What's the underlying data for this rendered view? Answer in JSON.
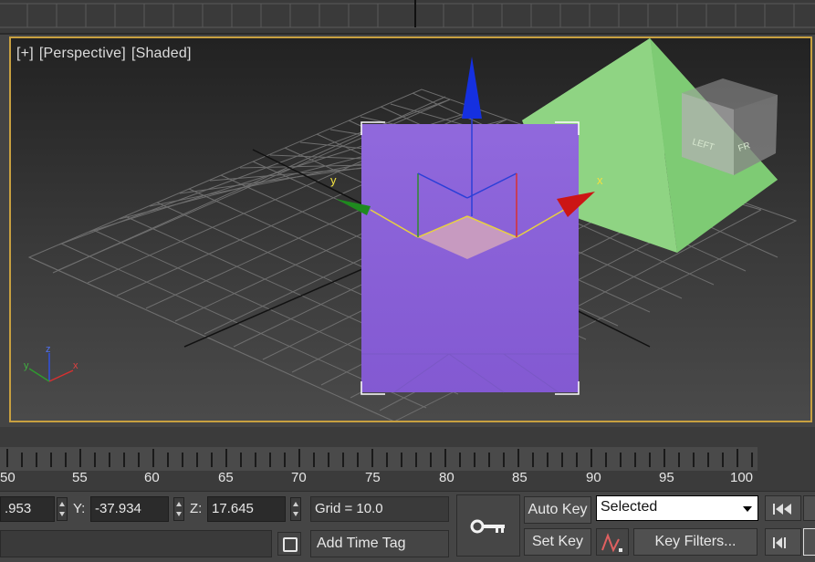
{
  "viewport": {
    "label_plus": "[+]",
    "label_view": "[Perspective]",
    "label_shading": "[Shaded]",
    "gizmo_x": "x",
    "gizmo_y": "y",
    "axis_tripod_x": "x",
    "axis_tripod_y": "y",
    "axis_tripod_z": "z",
    "viewcube_left": "LEFT",
    "viewcube_front": "FR"
  },
  "timeline": {
    "ticks": [
      "50",
      "55",
      "60",
      "65",
      "70",
      "75",
      "80",
      "85",
      "90",
      "95",
      "100"
    ]
  },
  "status": {
    "x_value": ".953",
    "y_label": "Y:",
    "y_value": "-37.934",
    "z_label": "Z:",
    "z_value": "17.645",
    "grid_text": "Grid = 10.0",
    "add_time_tag": "Add Time Tag",
    "auto_key": "Auto Key",
    "set_key": "Set Key",
    "selected": "Selected",
    "key_filters": "Key Filters..."
  }
}
